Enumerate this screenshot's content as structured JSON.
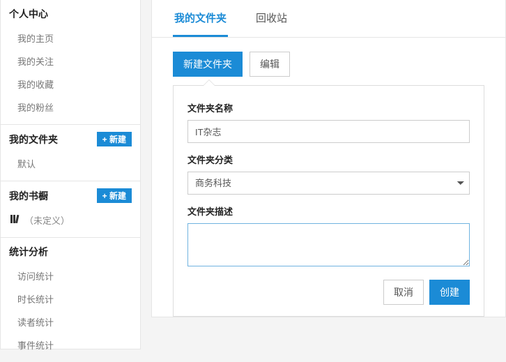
{
  "sidebar": {
    "sections": [
      {
        "title": "个人中心",
        "items": [
          "我的主页",
          "我的关注",
          "我的收藏",
          "我的粉丝"
        ]
      },
      {
        "title": "我的文件夹",
        "new_btn": "+ 新建",
        "items": [
          "默认"
        ]
      },
      {
        "title": "我的书橱",
        "new_btn": "+ 新建",
        "items": [
          "（未定义）"
        ]
      },
      {
        "title": "统计分析",
        "items": [
          "访问统计",
          "时长统计",
          "读者统计",
          "事件统计"
        ]
      }
    ]
  },
  "main": {
    "tabs": [
      "我的文件夹",
      "回收站"
    ],
    "toolbar": {
      "new_folder": "新建文件夹",
      "edit": "编辑"
    },
    "form": {
      "name_label": "文件夹名称",
      "name_value": "IT杂志",
      "category_label": "文件夹分类",
      "category_value": "商务科技",
      "desc_label": "文件夹描述",
      "desc_value": "",
      "cancel": "取消",
      "create": "创建"
    }
  }
}
